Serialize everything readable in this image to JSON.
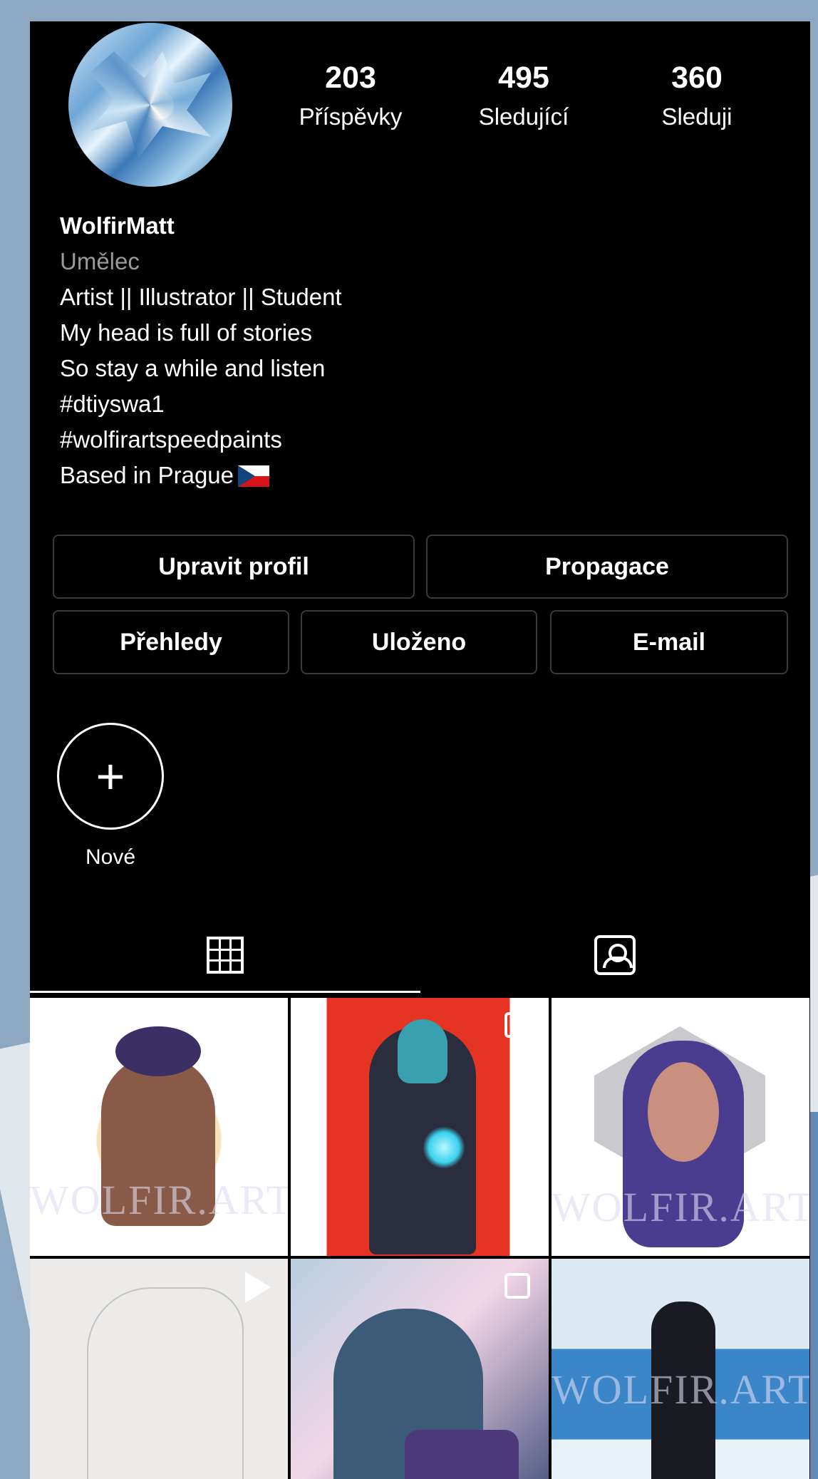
{
  "profile": {
    "username": "WolfirMatt",
    "category": "Umělec",
    "bio_lines": [
      "Artist || Illustrator || Student",
      "My head is full of stories",
      "So stay a while and listen",
      "#dtiyswa1",
      "#wolfirartspeedpaints",
      "Based in Prague"
    ]
  },
  "stats": [
    {
      "value": "203",
      "label": "Příspěvky"
    },
    {
      "value": "495",
      "label": "Sledující"
    },
    {
      "value": "360",
      "label": "Sleduji"
    }
  ],
  "buttons": {
    "edit_profile": "Upravit profil",
    "promotions": "Propagace",
    "insights": "Přehledy",
    "saved": "Uloženo",
    "email": "E-mail"
  },
  "story": {
    "new_symbol": "+",
    "new_label": "Nové"
  },
  "tabs": [
    {
      "name": "grid",
      "icon": "grid-icon",
      "active": true
    },
    {
      "name": "tagged",
      "icon": "tagged-person-icon",
      "active": false
    }
  ],
  "posts": [
    {
      "watermark": "WOLFIR.ART"
    },
    {
      "watermark": ""
    },
    {
      "watermark": "WOLFIR.ART"
    },
    {
      "watermark": ""
    },
    {
      "watermark": ""
    },
    {
      "watermark": "WOLFIR.ART"
    }
  ],
  "colors": {
    "background": "#000000",
    "button_border": "#3a3a3a",
    "muted_text": "#9a9a9a"
  }
}
